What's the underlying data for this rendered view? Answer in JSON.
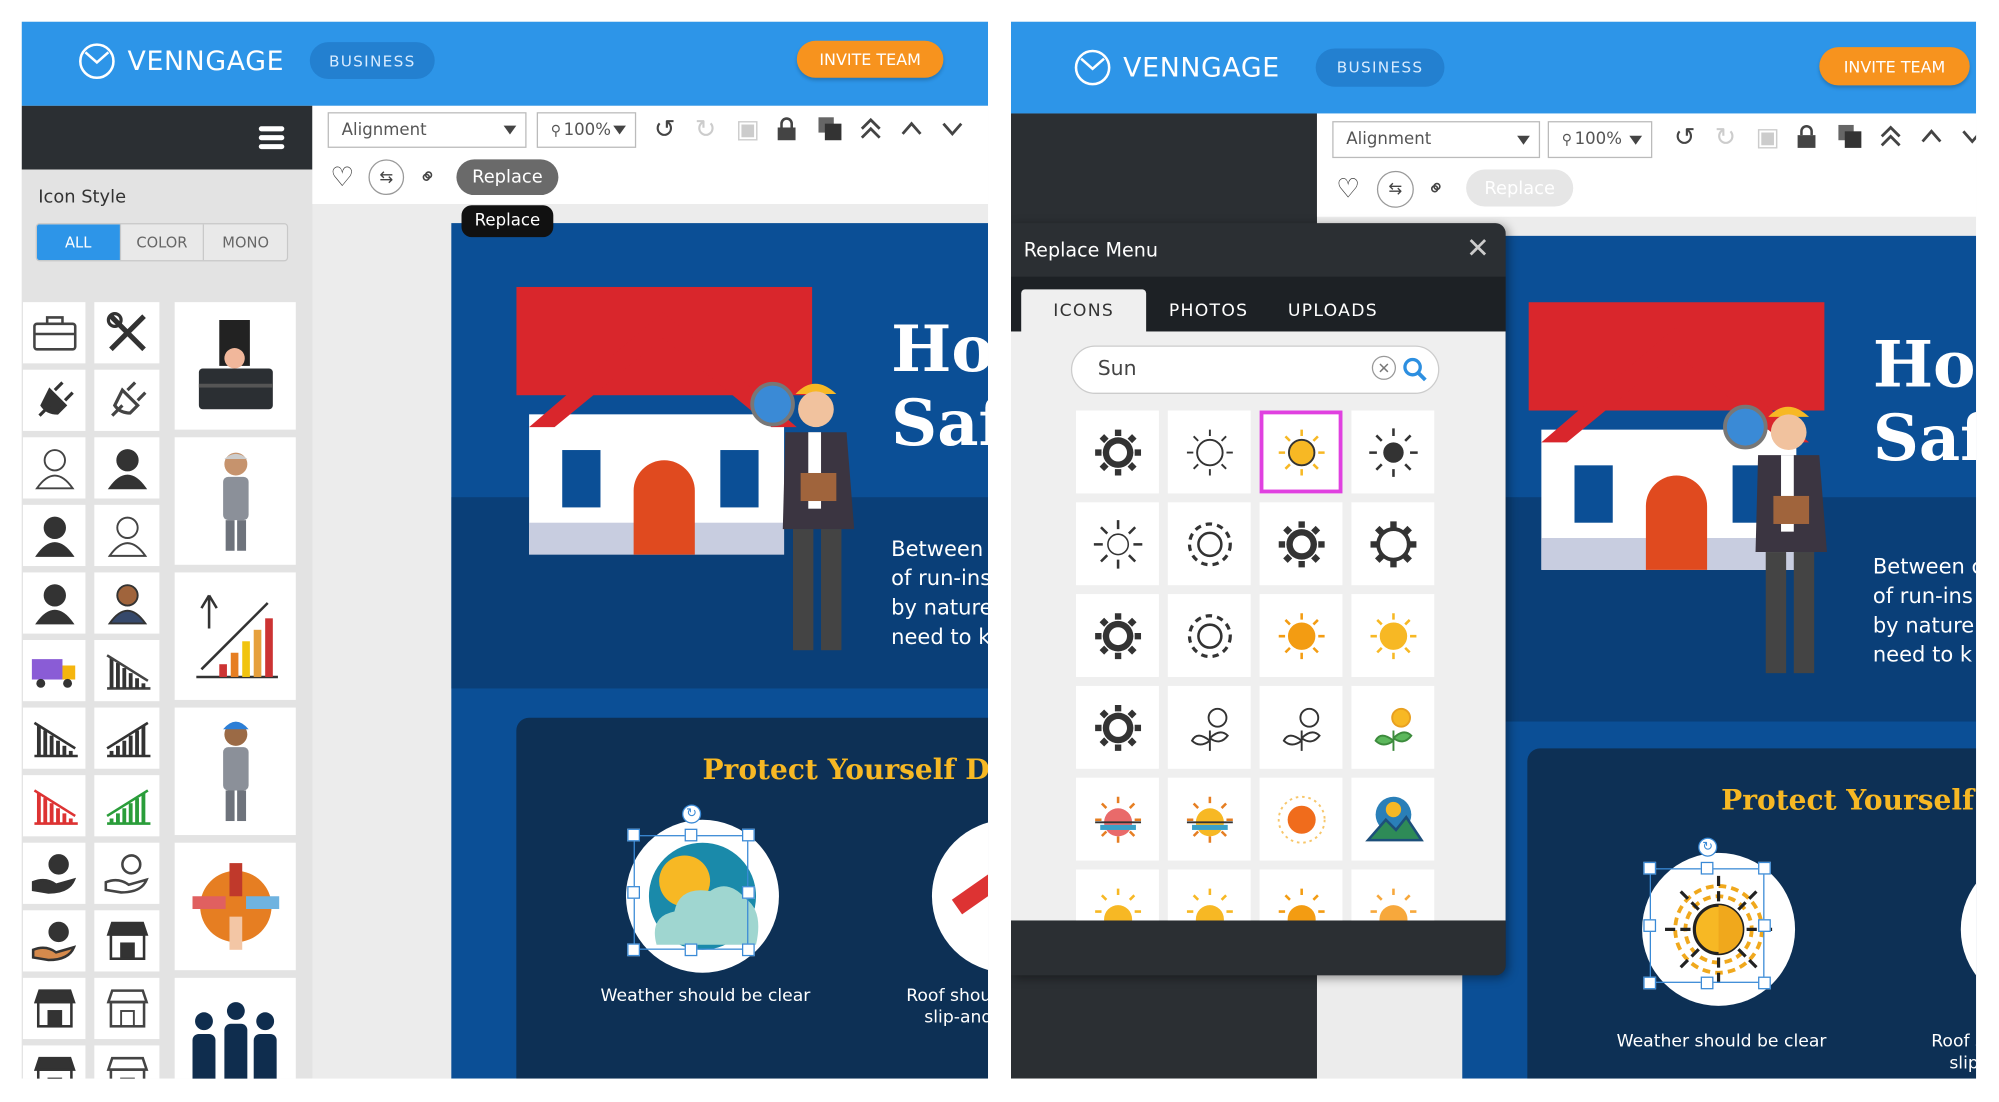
{
  "brand": {
    "name": "VENNGAGE",
    "plan": "BUSINESS",
    "invite": "INVITE TEAM",
    "accent": "#2d95e8",
    "invite_color": "#f7931e"
  },
  "toolbar": {
    "alignment": "Alignment",
    "zoom": "100%",
    "replace": "Replace",
    "tooltip": "Replace",
    "icons": [
      "undo-icon",
      "redo-icon",
      "group-icon",
      "lock-icon",
      "duplicate-icon",
      "bring-to-front-icon",
      "bring-forward-icon",
      "send-backward-icon"
    ]
  },
  "sidebar": {
    "title": "Icon Style",
    "tabs": [
      "ALL",
      "COLOR",
      "MONO"
    ],
    "active_tab": "ALL",
    "small_icons": [
      "briefcase",
      "tools",
      "plug",
      "plug-outline",
      "user-female-outline",
      "user-female",
      "user",
      "user-outline",
      "businessman",
      "businessman-color",
      "delivery-truck",
      "chart-down-outline",
      "chart-down",
      "chart-up",
      "chart-down-red",
      "chart-up-green",
      "money-hand",
      "money-hand-outline",
      "coin-hand",
      "shopping-cart",
      "store",
      "store-outline",
      "shop-awning",
      "shop-awning-outline"
    ],
    "large_icons": [
      "briefcase-hand",
      "old-businessman",
      "growth-chart",
      "turban-businessman",
      "teamwork-hands",
      "team-people"
    ]
  },
  "infographic": {
    "title_lines": [
      "Ho",
      "Saf"
    ],
    "body_lines": [
      "Between c",
      "of run-ins",
      "by nature",
      "need to k"
    ],
    "section_title": "Protect Yourself Du",
    "caption1": "Weather should be clear",
    "caption2_lines": [
      "Roof shou",
      "slip-and"
    ]
  },
  "replace_menu": {
    "title": "Replace Menu",
    "tabs": [
      "ICONS",
      "PHOTOS",
      "UPLOADS"
    ],
    "active_tab": "ICONS",
    "search_value": "Sun",
    "selected_index": 2,
    "selected_color": "#e040e0"
  }
}
